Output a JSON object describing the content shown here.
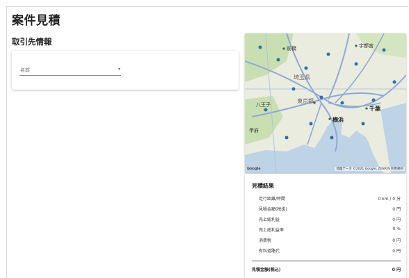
{
  "page": {
    "title": "案件見積"
  },
  "customer_section": {
    "title": "取引先情報",
    "select": {
      "label": "名前",
      "caret": "▾"
    }
  },
  "map": {
    "labels": [
      {
        "text": "前橋",
        "name": "map-label-maebashi"
      },
      {
        "text": "宇都宮",
        "name": "map-label-utsunomiya"
      },
      {
        "text": "埼玉県",
        "name": "map-label-saitama"
      },
      {
        "text": "東京都",
        "name": "map-label-tokyo"
      },
      {
        "text": "八王子",
        "name": "map-label-hachioji"
      },
      {
        "text": "千葉",
        "name": "map-label-chiba"
      },
      {
        "text": "横浜",
        "name": "map-label-yokohama"
      },
      {
        "text": "甲府",
        "name": "map-label-kofu"
      }
    ],
    "attribution": "地図データ ©2021 Google, ZENRIN  利用規約",
    "google_mark": "Google",
    "colors": {
      "sea": "#bfd3e6",
      "land": "#e9ecdf",
      "green": "#c9dfb2",
      "road": "#8fa9d6",
      "pin": "#2f6fae"
    }
  },
  "results": {
    "title": "見積結果",
    "rows": [
      {
        "key": "走行距離/時間",
        "value": "0 km / 0 分"
      },
      {
        "key": "見積金額(税抜)",
        "value": "0 円"
      },
      {
        "key": "売上総利益",
        "value": "0 円"
      },
      {
        "key": "売上総利益率",
        "value": "0 %"
      },
      {
        "key": "消費税",
        "value": "0 円"
      },
      {
        "key": "有料道路代",
        "value": "0 円"
      }
    ],
    "total": {
      "key": "見積金額(税込)",
      "value": "0 円"
    }
  }
}
